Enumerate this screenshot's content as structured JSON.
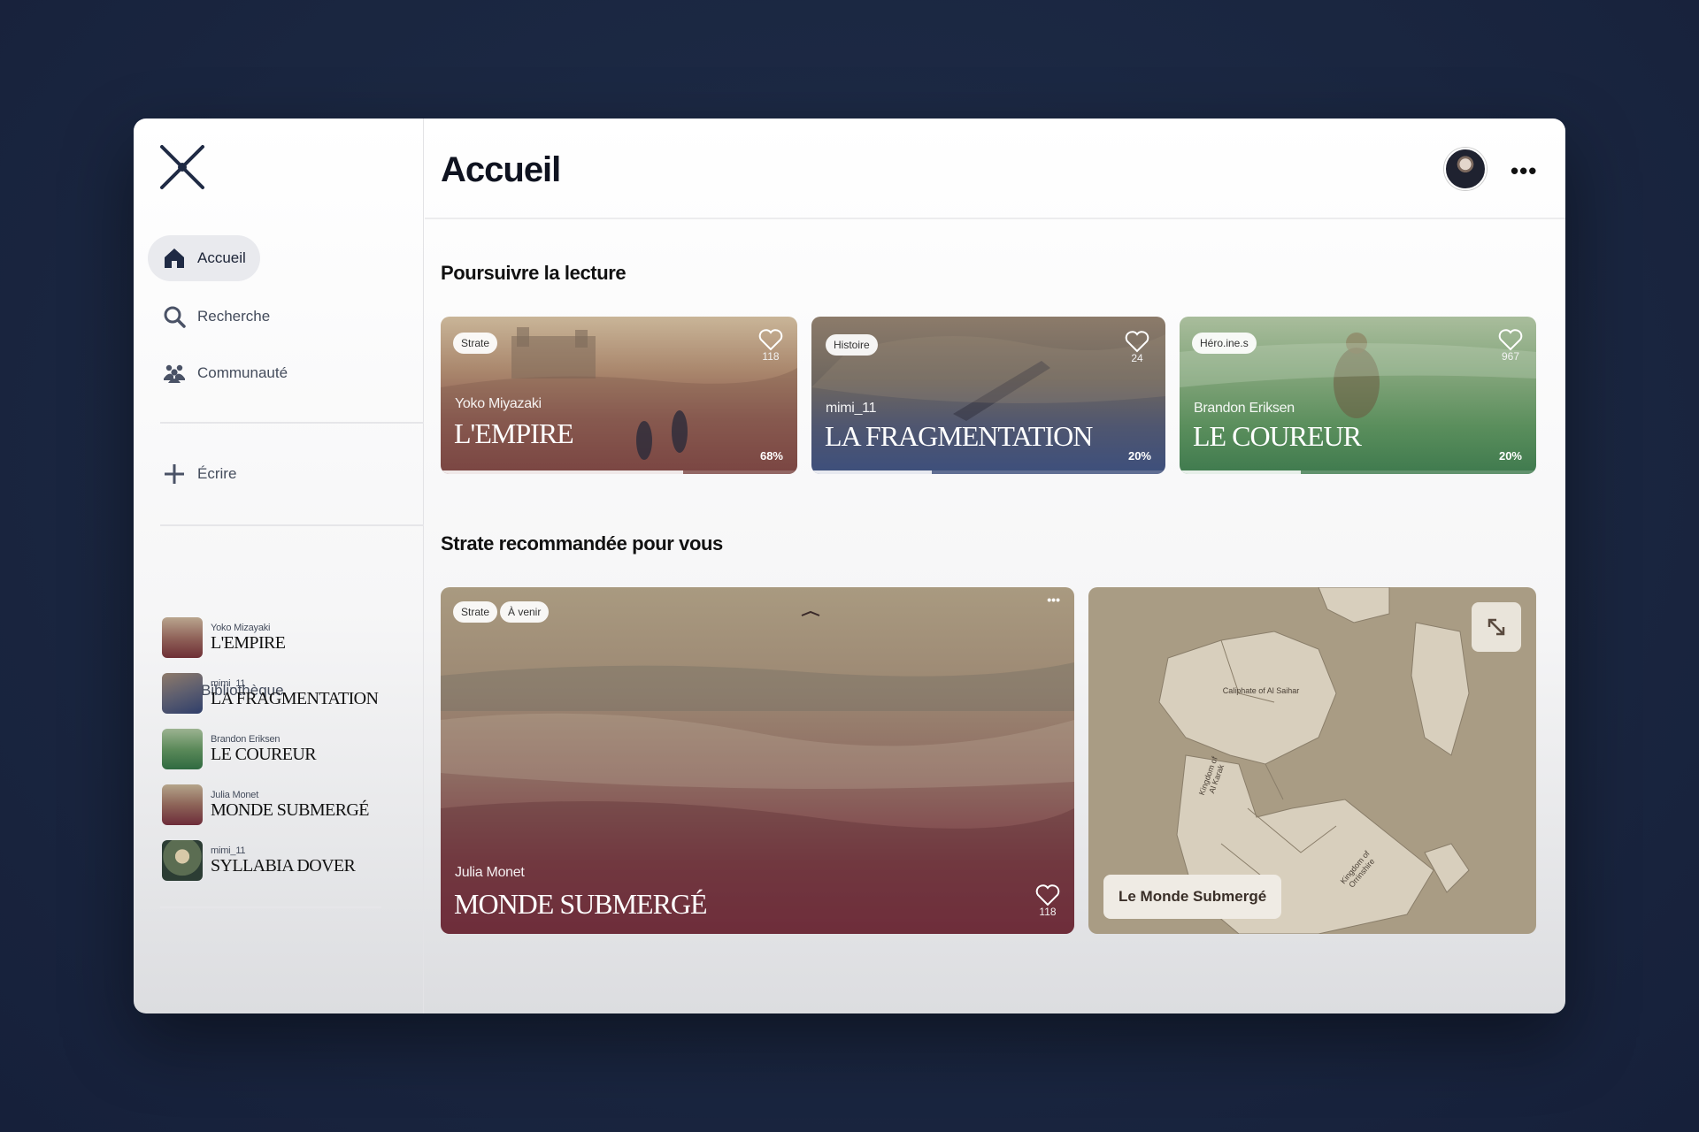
{
  "nav": {
    "home": "Accueil",
    "search": "Recherche",
    "community": "Communauté",
    "write": "Écrire",
    "library": "Bibliothèque"
  },
  "library": [
    {
      "author": "Yoko Mizayaki",
      "title": "L'EMPIRE"
    },
    {
      "author": "mimi_11",
      "title": "LA FRAGMENTATION"
    },
    {
      "author": "Brandon Eriksen",
      "title": "LE COUREUR"
    },
    {
      "author": "Julia Monet",
      "title": "MONDE SUBMERGÉ"
    },
    {
      "author": "mimi_11",
      "title": "SYLLABIA DOVER"
    }
  ],
  "header": {
    "title": "Accueil",
    "more": "•••"
  },
  "continue_reading": {
    "title": "Poursuivre la lecture",
    "cards": [
      {
        "tag": "Strate",
        "likes": "118",
        "author": "Yoko Miyazaki",
        "title": "L'EMPIRE",
        "progress": "68%",
        "color": "#7a3b3e"
      },
      {
        "tag": "Histoire",
        "likes": "24",
        "author": "mimi_11",
        "title": "LA FRAGMENTATION",
        "progress": "20%",
        "color": "#3d4f7c"
      },
      {
        "tag": "Héro.ine.s",
        "likes": "967",
        "author": "Brandon Eriksen",
        "title": "LE COUREUR",
        "progress": "20%",
        "color": "#3f7a4e"
      }
    ]
  },
  "recommended": {
    "title": "Strate recommandée pour vous",
    "tags": [
      "Strate",
      "À venir"
    ],
    "menu": "•••",
    "author": "Julia Monet",
    "book_title": "MONDE SUBMERGÉ",
    "likes": "118",
    "map_chip": "Le Monde Submergé",
    "map_labels": [
      "Caliphate of Al Saihar",
      "Kingdom of Al Karak",
      "Kingdom of Orrinshire"
    ]
  }
}
